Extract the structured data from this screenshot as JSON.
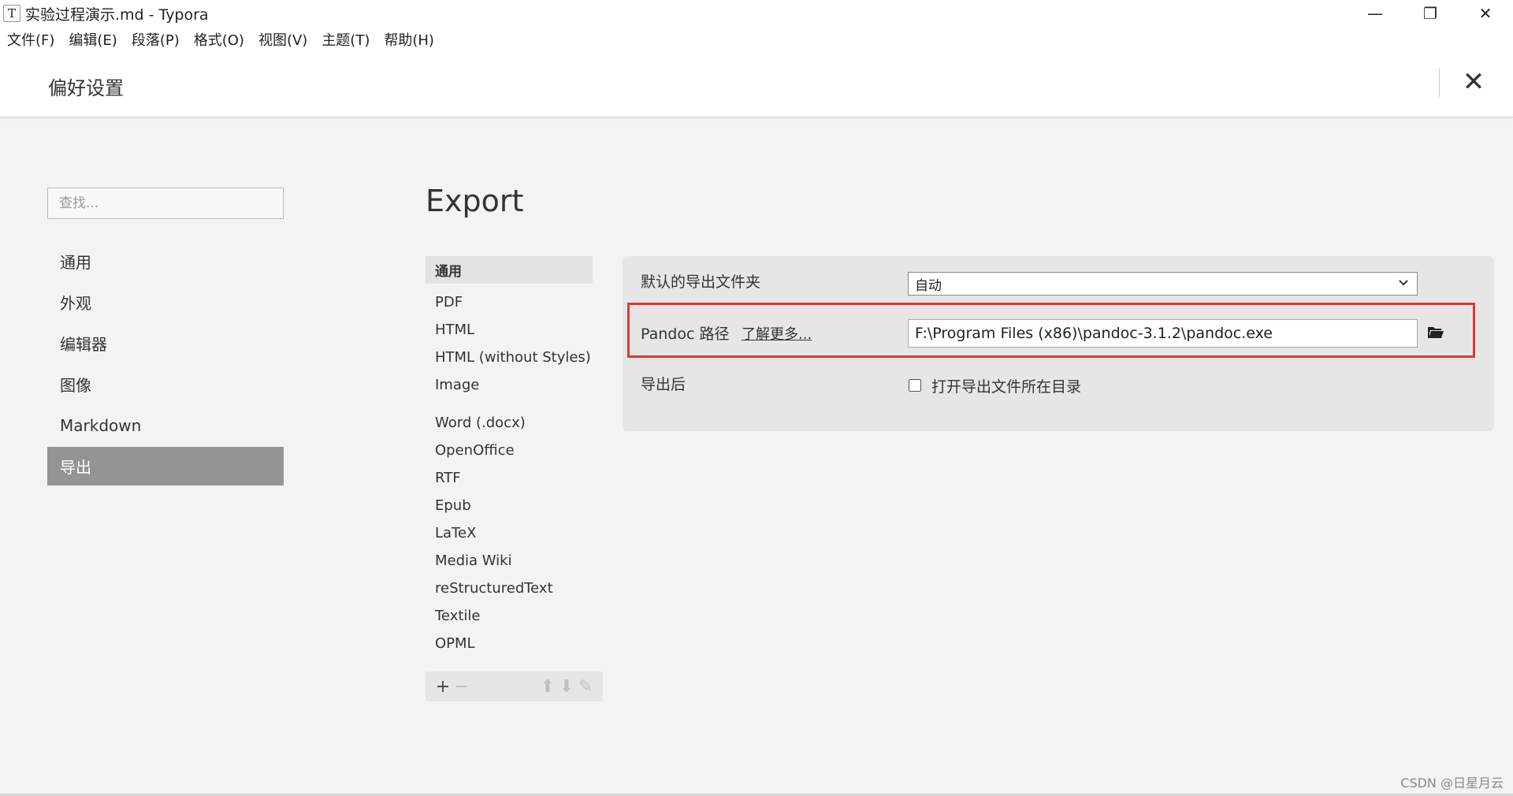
{
  "window": {
    "icon_letter": "T",
    "title": "实验过程演示.md - Typora",
    "minimize": "—",
    "restore": "❐",
    "close": "✕"
  },
  "menu": [
    "文件(F)",
    "编辑(E)",
    "段落(P)",
    "格式(O)",
    "视图(V)",
    "主题(T)",
    "帮助(H)"
  ],
  "preferences": {
    "title": "偏好设置",
    "close": "✕"
  },
  "search": {
    "placeholder": "查找..."
  },
  "sidebar": {
    "items": [
      {
        "label": "通用"
      },
      {
        "label": "外观"
      },
      {
        "label": "编辑器"
      },
      {
        "label": "图像"
      },
      {
        "label": "Markdown"
      },
      {
        "label": "导出",
        "active": true
      }
    ]
  },
  "export": {
    "heading": "Export",
    "formats_header": "通用",
    "formats_group1": [
      "PDF",
      "HTML",
      "HTML (without Styles)",
      "Image"
    ],
    "formats_group2": [
      "Word (.docx)",
      "OpenOffice",
      "RTF",
      "Epub",
      "LaTeX",
      "Media Wiki",
      "reStructuredText",
      "Textile",
      "OPML"
    ],
    "toolbar": {
      "add": "+",
      "remove": "−",
      "up": "⬆",
      "down": "⬇",
      "edit": "✎"
    }
  },
  "settings": {
    "default_folder_label": "默认的导出文件夹",
    "default_folder_value": "自动",
    "pandoc_label": "Pandoc 路径",
    "learn_more": "了解更多...",
    "pandoc_path": "F:\\Program Files (x86)\\pandoc-3.1.2\\pandoc.exe",
    "after_export_label": "导出后",
    "open_dir_label": "打开导出文件所在目录",
    "open_dir_checked": false,
    "highlight_color": "#e03636"
  },
  "watermark": "CSDN @日星月云"
}
